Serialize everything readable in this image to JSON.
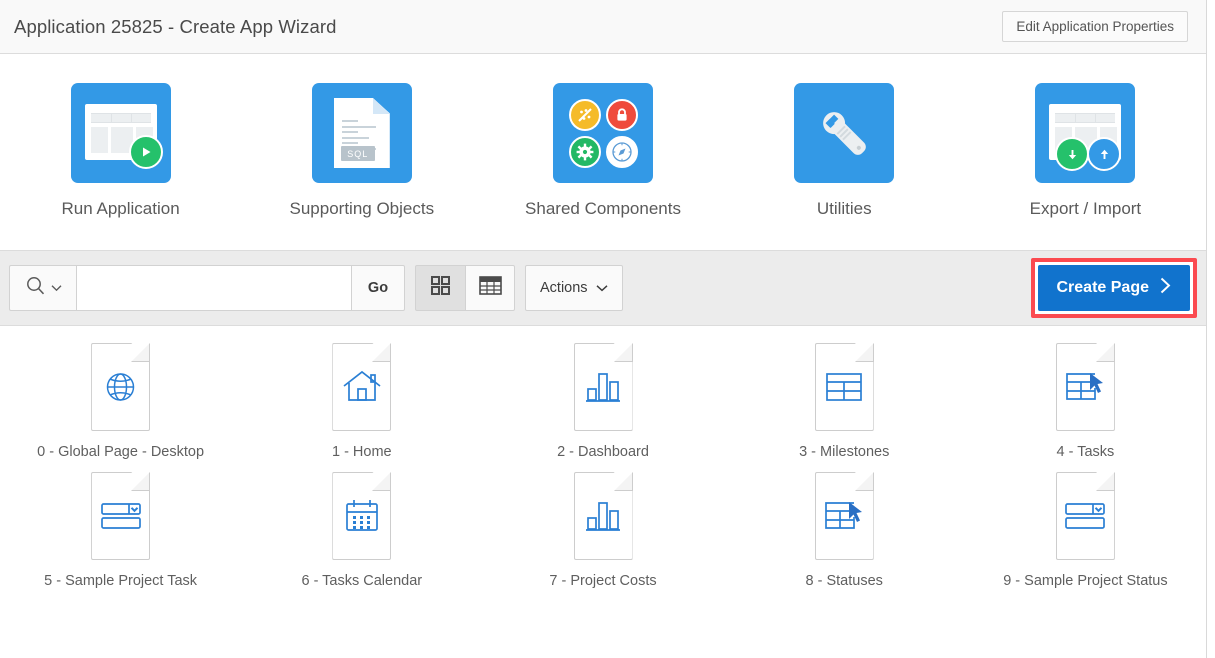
{
  "header": {
    "title": "Application 25825 - Create App Wizard",
    "edit_properties_label": "Edit Application Properties"
  },
  "tiles": [
    {
      "label": "Run Application",
      "icon": "run-application-icon"
    },
    {
      "label": "Supporting Objects",
      "icon": "supporting-objects-icon"
    },
    {
      "label": "Shared Components",
      "icon": "shared-components-icon"
    },
    {
      "label": "Utilities",
      "icon": "utilities-wrench-icon"
    },
    {
      "label": "Export / Import",
      "icon": "export-import-icon"
    }
  ],
  "toolbar": {
    "search_icon": "magnifier-icon",
    "search_chevron_icon": "chevron-down-icon",
    "search_value": "",
    "search_placeholder": "",
    "go_label": "Go",
    "icon_view_label": "icon-view-icon",
    "report_view_label": "report-view-icon",
    "icon_view_selected": true,
    "actions_label": "Actions",
    "actions_chevron_icon": "chevron-down-icon",
    "create_page_label": "Create Page",
    "create_page_chevron_icon": "chevron-right-icon",
    "highlight_color": "#fb4a50",
    "create_page_color": "#1173cd"
  },
  "pages": [
    {
      "label": "0 - Global Page - Desktop",
      "icon": "globe-icon"
    },
    {
      "label": "1 - Home",
      "icon": "home-icon"
    },
    {
      "label": "2 - Dashboard",
      "icon": "bar-chart-icon"
    },
    {
      "label": "3 - Milestones",
      "icon": "table-grid-icon"
    },
    {
      "label": "4 - Tasks",
      "icon": "interactive-grid-icon"
    },
    {
      "label": "5 - Sample Project Task",
      "icon": "form-icon"
    },
    {
      "label": "6 - Tasks Calendar",
      "icon": "calendar-icon"
    },
    {
      "label": "7 - Project Costs",
      "icon": "bar-chart-icon"
    },
    {
      "label": "8 - Statuses",
      "icon": "interactive-grid-icon"
    },
    {
      "label": "9 - Sample Project Status",
      "icon": "form-icon"
    }
  ],
  "colors": {
    "tile_blue": "#3399e6",
    "glyph_blue": "#2a7fd4",
    "toolbar_bg": "#ececec"
  }
}
